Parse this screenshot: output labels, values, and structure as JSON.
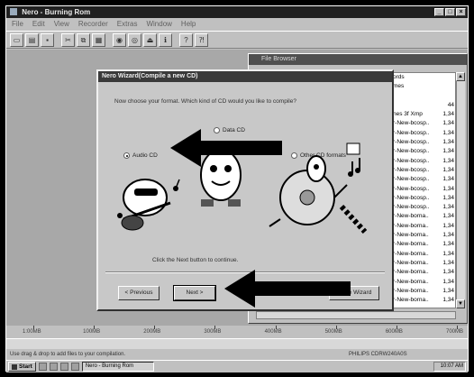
{
  "window": {
    "title": "Nero - Burning Rom",
    "controls": [
      "_",
      "□",
      "×"
    ]
  },
  "menu": [
    "File",
    "Edit",
    "View",
    "Recorder",
    "Extras",
    "Window",
    "Help"
  ],
  "toolbar": {
    "icons": [
      "new-icon",
      "open-icon",
      "save-icon",
      "cut-icon",
      "copy-icon",
      "paste-icon",
      "record-icon",
      "burn-icon",
      "eject-icon",
      "info-icon",
      "help-icon",
      "whatsthis-icon"
    ]
  },
  "list_window": {
    "title": "File Browser",
    "rows": [
      {
        "name": "ords",
        "size": ""
      },
      {
        "name": "mes",
        "size": ""
      },
      {
        "name": "",
        "size": ""
      },
      {
        "name": "",
        "size": "44"
      },
      {
        "name": "nes 3f  Xmp",
        "size": "1,34"
      },
      {
        "name": "r-New-bcosp..",
        "size": "1,34"
      },
      {
        "name": "r-New-bcosp..",
        "size": "1,34"
      },
      {
        "name": "r-New-bcosp..",
        "size": "1,34"
      },
      {
        "name": "r-New-bcosp..",
        "size": "1,34"
      },
      {
        "name": "r-New-bcosp..",
        "size": "1,34"
      },
      {
        "name": "r-New-bcosp..",
        "size": "1,34"
      },
      {
        "name": "r-New-bcosp..",
        "size": "1,34"
      },
      {
        "name": "r-New-bcosp..",
        "size": "1,34"
      },
      {
        "name": "r-New-bcosp..",
        "size": "1,34"
      },
      {
        "name": "r-New-bcosp..",
        "size": "1,34"
      },
      {
        "name": "r-New-borna..",
        "size": "1,34"
      },
      {
        "name": "r-New-borna..",
        "size": "1,34"
      },
      {
        "name": "r-New-borna..",
        "size": "1,34"
      },
      {
        "name": "r-New-borna..",
        "size": "1,34"
      },
      {
        "name": "r-New-borna..",
        "size": "1,34"
      },
      {
        "name": "r-New-borna..",
        "size": "1,34"
      },
      {
        "name": "r-New-borna..",
        "size": "1,34"
      },
      {
        "name": "r-New-borna..",
        "size": "1,34"
      },
      {
        "name": "r-New-borna..",
        "size": "1,34"
      },
      {
        "name": "r-New-borna..",
        "size": "1,34"
      }
    ]
  },
  "wizard": {
    "title": "Nero Wizard(Compile a new CD)",
    "question": "Now choose your format. Which kind of CD would you like to compile?",
    "options": {
      "data": "Data CD",
      "audio": "Audio CD",
      "other": "Other CD formats"
    },
    "selected": "audio",
    "hint": "Click the Next button to continue.",
    "buttons": {
      "back": "< Previous",
      "next": "Next >",
      "wizard": "Close Wizard"
    }
  },
  "ruler": {
    "ticks": [
      "1:00MB",
      "100MB",
      "200MB",
      "300MB",
      "400MB",
      "500MB",
      "600MB",
      "700MB"
    ]
  },
  "status": {
    "left": "Use drag & drop to add files to your compilation.",
    "right": "PHILIPS CDRW240A0S"
  },
  "taskbar": {
    "start": "Start",
    "task": "Nero - Burning Rom",
    "clock": "10:07 AM"
  }
}
